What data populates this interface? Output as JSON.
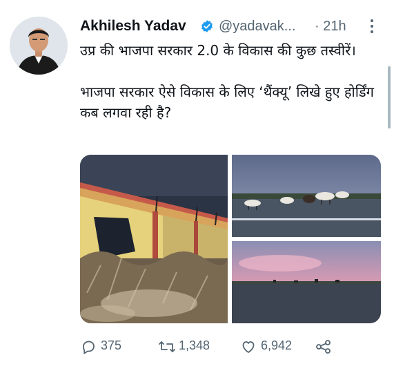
{
  "tweet": {
    "author_name": "Akhilesh Yadav",
    "handle": "@yadavak...",
    "separator": "·",
    "time": "21h",
    "text_line1": "उप्र की भाजपा सरकार 2.0 के विकास की कुछ तस्वीरें।",
    "text_line2": "भाजपा सरकार ऐसे विकास के लिए ‘थैंक्यू’ लिखे हुए होर्डिंग कब लगवा रही है?"
  },
  "actions": {
    "replies": "375",
    "retweets": "1,348",
    "likes": "6,942"
  },
  "colors": {
    "text_primary": "#0f1419",
    "text_secondary": "#536471",
    "verified_blue": "#1d9bf0"
  },
  "icons": [
    "verified-badge-icon",
    "more-icon",
    "reply-icon",
    "retweet-icon",
    "like-icon",
    "share-icon"
  ]
}
